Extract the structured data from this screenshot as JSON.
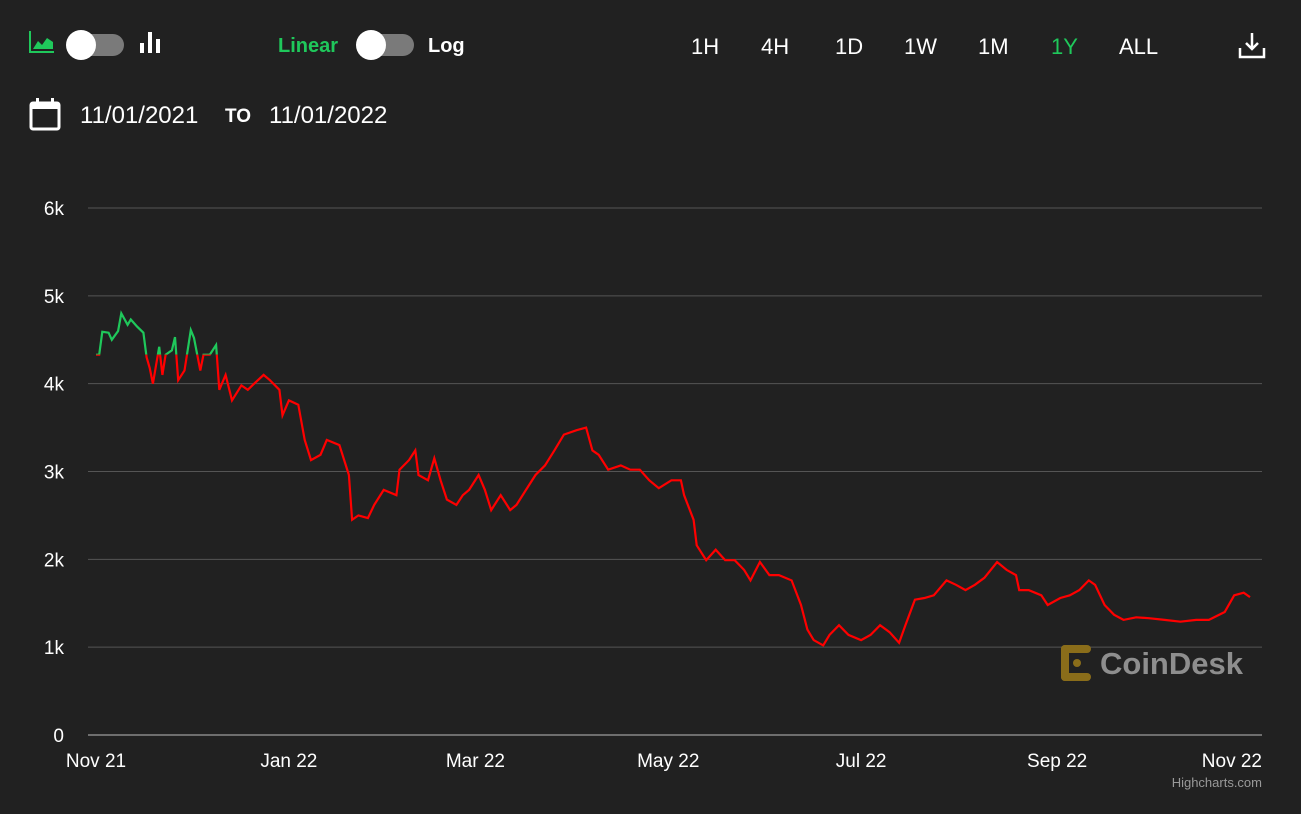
{
  "toolbar": {
    "chart_type_left": "area-chart-icon",
    "chart_type_right": "bar-chart-icon",
    "scale_linear_label": "Linear",
    "scale_log_label": "Log",
    "ranges": [
      "1H",
      "4H",
      "1D",
      "1W",
      "1M",
      "1Y",
      "ALL"
    ],
    "active_range": "1Y",
    "download_icon": "download-icon"
  },
  "date_range": {
    "from": "11/01/2021",
    "to_label": "TO",
    "to": "11/01/2022"
  },
  "watermark": "CoinDesk",
  "credits": "Highcharts.com",
  "colors": {
    "up": "#1fc85b",
    "down": "#ff0000",
    "accent": "#1fc85b",
    "grid": "#555555"
  },
  "chart_data": {
    "type": "line",
    "x_unit": "days since Nov 1 2021",
    "x": [
      0,
      1,
      2,
      4,
      5,
      7,
      8,
      10,
      11,
      13,
      15,
      16,
      17,
      18,
      20,
      21,
      22,
      24,
      25,
      26,
      28,
      30,
      31,
      33,
      34,
      36,
      38,
      39,
      41,
      43,
      46,
      48,
      50,
      53,
      55,
      58,
      59,
      61,
      64,
      66,
      68,
      71,
      73,
      77,
      80,
      81,
      83,
      86,
      88,
      91,
      95,
      96,
      99,
      101,
      102,
      105,
      107,
      109,
      111,
      114,
      116,
      118,
      121,
      123,
      125,
      128,
      131,
      133,
      136,
      139,
      142,
      145,
      148,
      152,
      155,
      157,
      159,
      162,
      166,
      169,
      172,
      175,
      178,
      182,
      185,
      186,
      189,
      190,
      193,
      196,
      199,
      202,
      205,
      207,
      210,
      213,
      216,
      220,
      223,
      225,
      227,
      230,
      232,
      235,
      238,
      242,
      245,
      248,
      251,
      254,
      256,
      259,
      262,
      265,
      269,
      272,
      275,
      278,
      281,
      285,
      288,
      291,
      292,
      295,
      299,
      301,
      305,
      308,
      311,
      314,
      316,
      319,
      322,
      325,
      329,
      333,
      338,
      343,
      348,
      352,
      357,
      360,
      363,
      365
    ],
    "y": [
      4330,
      4330,
      4590,
      4580,
      4500,
      4600,
      4800,
      4670,
      4730,
      4650,
      4580,
      4300,
      4180,
      4000,
      4420,
      4100,
      4330,
      4380,
      4530,
      4040,
      4150,
      4610,
      4520,
      4150,
      4330,
      4330,
      4440,
      3930,
      4100,
      3810,
      3980,
      3930,
      4000,
      4100,
      4040,
      3930,
      3640,
      3810,
      3760,
      3360,
      3130,
      3190,
      3360,
      3300,
      2960,
      2450,
      2500,
      2470,
      2620,
      2790,
      2730,
      3020,
      3130,
      3240,
      2960,
      2900,
      3150,
      2900,
      2680,
      2620,
      2730,
      2790,
      2960,
      2790,
      2560,
      2730,
      2560,
      2620,
      2790,
      2960,
      3070,
      3240,
      3420,
      3470,
      3500,
      3240,
      3190,
      3020,
      3070,
      3020,
      3020,
      2900,
      2810,
      2900,
      2900,
      2730,
      2450,
      2160,
      1990,
      2110,
      1990,
      1990,
      1880,
      1760,
      1970,
      1820,
      1820,
      1760,
      1480,
      1200,
      1080,
      1020,
      1140,
      1250,
      1140,
      1080,
      1140,
      1250,
      1170,
      1050,
      1250,
      1540,
      1560,
      1590,
      1760,
      1710,
      1650,
      1710,
      1790,
      1970,
      1880,
      1820,
      1650,
      1650,
      1590,
      1480,
      1560,
      1590,
      1650,
      1760,
      1710,
      1480,
      1370,
      1310,
      1340,
      1330,
      1310,
      1290,
      1310,
      1310,
      1400,
      1590,
      1620,
      1570
    ],
    "threshold": 4330,
    "x_ticks": [
      {
        "label": "Nov 21",
        "day": 0
      },
      {
        "label": "Jan 22",
        "day": 61
      },
      {
        "label": "Mar 22",
        "day": 120
      },
      {
        "label": "May 22",
        "day": 181
      },
      {
        "label": "Jul 22",
        "day": 242
      },
      {
        "label": "Sep 22",
        "day": 304
      },
      {
        "label": "Nov 22",
        "day": 365
      }
    ],
    "y_ticks": [
      {
        "label": "0",
        "value": 0
      },
      {
        "label": "1k",
        "value": 1000
      },
      {
        "label": "2k",
        "value": 2000
      },
      {
        "label": "3k",
        "value": 3000
      },
      {
        "label": "4k",
        "value": 4000
      },
      {
        "label": "5k",
        "value": 5000
      },
      {
        "label": "6k",
        "value": 6000
      }
    ],
    "ylim": [
      0,
      6000
    ],
    "xlim": [
      0,
      365
    ],
    "grid": true,
    "title": "",
    "xlabel": "",
    "ylabel": ""
  }
}
